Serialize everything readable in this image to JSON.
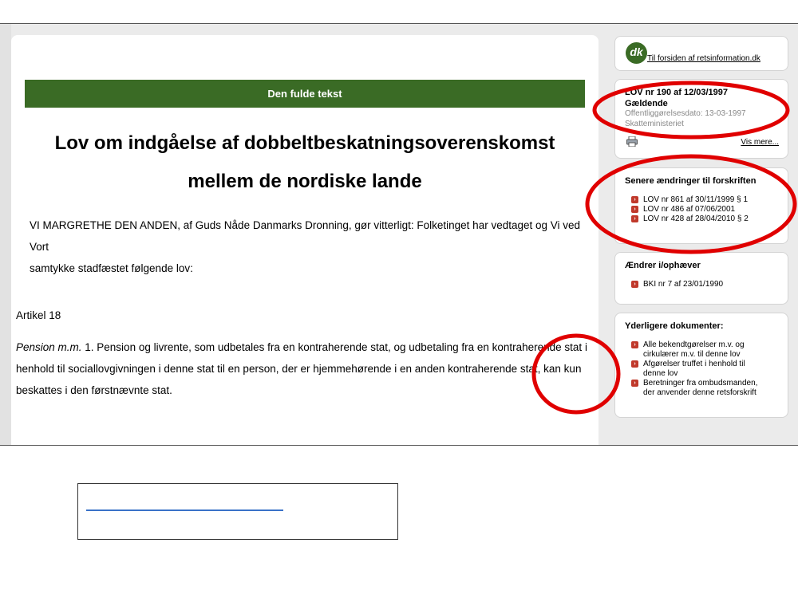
{
  "document": {
    "banner": "Den fulde tekst",
    "title_line1": "Lov om indgåelse af dobbeltbeskatningsoverenskomst",
    "title_line2": "mellem de nordiske lande",
    "intro_line1": "VI MARGRETHE DEN ANDEN, af Guds Nåde Danmarks Dronning, gør vitterligt: Folketinget har vedtaget og Vi ved Vort",
    "intro_line2": "samtykke stadfæstet følgende lov:",
    "article": "Artikel 18",
    "pension_italic": "Pension m.m.",
    "pension_line1_rest": " 1. Pension og livrente, som udbetales fra en kontraherende stat, og udbetaling fra en kontraherende stat i",
    "pension_line2": "henhold til sociallovgivningen i denne stat til en person, der er hjemmehørende i en anden kontraherende stat, kan kun",
    "pension_line3": "beskattes i den førstnævnte stat."
  },
  "sidebar": {
    "logo_text": "dk",
    "forside_link": "Til forsiden af retsinformation.dk",
    "lov_title": "LOV nr 190 af 12/03/1997",
    "lov_status": "Gældende",
    "lov_date": "Offentliggørelsesdato: 13-03-1997",
    "lov_ministry": "Skatteministeriet",
    "vis_mere": "Vis mere...",
    "changes_head": "Senere ændringer til forskriften",
    "changes": [
      "LOV nr 861 af 30/11/1999 § 1",
      "LOV nr 486 af 07/06/2001",
      "LOV nr 428 af 28/04/2010 § 2"
    ],
    "amends_head": "Ændrer i/ophæver",
    "amends": [
      "BKI nr 7 af 23/01/1990"
    ],
    "docs_head": "Yderligere dokumenter:",
    "docs": [
      [
        "Alle bekendtgørelser m.v. og",
        "cirkulærer m.v. til denne lov"
      ],
      [
        "Afgørelser truffet i henhold til",
        "denne lov"
      ],
      [
        "Beretninger fra ombudsmanden,",
        "der anvender denne retsforskrift"
      ]
    ]
  },
  "colors": {
    "banner_green": "#3a6b25",
    "annotation_red": "#e00000",
    "bullet_red": "#c0392b"
  }
}
